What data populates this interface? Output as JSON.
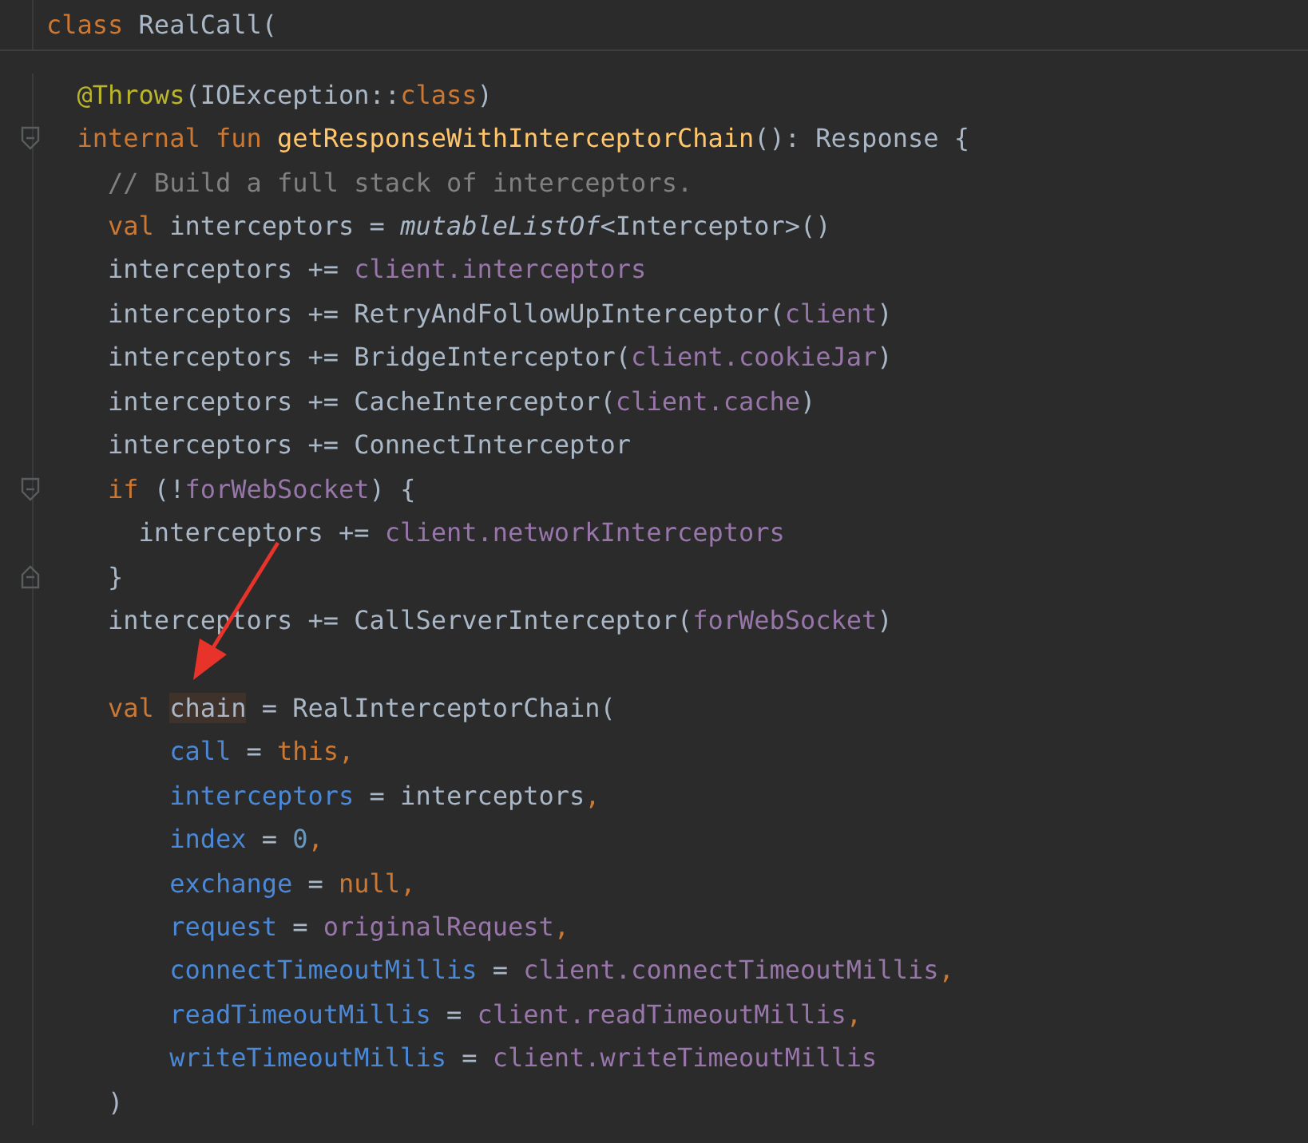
{
  "sticky_header": {
    "tokens": [
      {
        "text": "class ",
        "kind": "keyword"
      },
      {
        "text": "RealCall(",
        "kind": "plain"
      }
    ]
  },
  "lines": [
    {
      "kind": "code",
      "tokens": [
        {
          "text": "@Throws",
          "kind": "annotation"
        },
        {
          "text": "(IOException::",
          "kind": "plain"
        },
        {
          "text": "class",
          "kind": "keyword"
        },
        {
          "text": ")",
          "kind": "plain"
        }
      ]
    },
    {
      "kind": "fold-start",
      "tokens": [
        {
          "text": "internal fun ",
          "kind": "keyword"
        },
        {
          "text": "getResponseWithInterceptorChain",
          "kind": "function"
        },
        {
          "text": "(): Response {",
          "kind": "plain"
        }
      ],
      "children": [
        {
          "kind": "code",
          "tokens": [
            {
              "text": "// Build a full stack of interceptors.",
              "kind": "comment"
            }
          ]
        },
        {
          "kind": "code",
          "tokens": [
            {
              "text": "val ",
              "kind": "keyword"
            },
            {
              "text": "interceptors = ",
              "kind": "plain"
            },
            {
              "text": "mutableListOf",
              "kind": "call"
            },
            {
              "text": "<Interceptor>()",
              "kind": "plain"
            }
          ]
        },
        {
          "kind": "code",
          "tokens": [
            {
              "text": "interceptors += ",
              "kind": "plain"
            },
            {
              "text": "client.interceptors",
              "kind": "property"
            }
          ]
        },
        {
          "kind": "code",
          "tokens": [
            {
              "text": "interceptors += RetryAndFollowUpInterceptor(",
              "kind": "plain"
            },
            {
              "text": "client",
              "kind": "property"
            },
            {
              "text": ")",
              "kind": "plain"
            }
          ]
        },
        {
          "kind": "code",
          "tokens": [
            {
              "text": "interceptors += BridgeInterceptor(",
              "kind": "plain"
            },
            {
              "text": "client.cookieJar",
              "kind": "property"
            },
            {
              "text": ")",
              "kind": "plain"
            }
          ]
        },
        {
          "kind": "code",
          "tokens": [
            {
              "text": "interceptors += CacheInterceptor(",
              "kind": "plain"
            },
            {
              "text": "client.cache",
              "kind": "property"
            },
            {
              "text": ")",
              "kind": "plain"
            }
          ]
        },
        {
          "kind": "code",
          "tokens": [
            {
              "text": "interceptors += ConnectInterceptor",
              "kind": "plain"
            }
          ]
        },
        {
          "kind": "fold-start",
          "tokens": [
            {
              "text": "if",
              "kind": "keyword"
            },
            {
              "text": " (!",
              "kind": "plain"
            },
            {
              "text": "forWebSocket",
              "kind": "property"
            },
            {
              "text": ") {",
              "kind": "plain"
            }
          ],
          "children": [
            {
              "kind": "code",
              "tokens": [
                {
                  "text": "interceptors += ",
                  "kind": "plain"
                },
                {
                  "text": "client.networkInterceptors",
                  "kind": "property"
                }
              ]
            }
          ]
        },
        {
          "kind": "fold-end",
          "tokens": [
            {
              "text": "}",
              "kind": "plain"
            }
          ]
        },
        {
          "kind": "code",
          "tokens": [
            {
              "text": "interceptors += CallServerInterceptor(",
              "kind": "plain"
            },
            {
              "text": "forWebSocket",
              "kind": "property"
            },
            {
              "text": ")",
              "kind": "plain"
            }
          ]
        },
        {
          "kind": "blank"
        },
        {
          "kind": "call-open",
          "tokens": [
            {
              "text": "val ",
              "kind": "keyword"
            },
            {
              "text": "chain",
              "kind": "highlighted"
            },
            {
              "text": " = RealInterceptorChain(",
              "kind": "plain"
            }
          ],
          "children": [
            {
              "kind": "code",
              "tokens": [
                {
                  "text": "call",
                  "kind": "param"
                },
                {
                  "text": " = ",
                  "kind": "plain"
                },
                {
                  "text": "this",
                  "kind": "keyword"
                },
                {
                  "text": ",",
                  "kind": "keyword"
                }
              ]
            },
            {
              "kind": "code",
              "tokens": [
                {
                  "text": "interceptors",
                  "kind": "param"
                },
                {
                  "text": " = interceptors",
                  "kind": "plain"
                },
                {
                  "text": ",",
                  "kind": "keyword"
                }
              ]
            },
            {
              "kind": "code",
              "tokens": [
                {
                  "text": "index",
                  "kind": "param"
                },
                {
                  "text": " = ",
                  "kind": "plain"
                },
                {
                  "text": "0",
                  "kind": "number"
                },
                {
                  "text": ",",
                  "kind": "keyword"
                }
              ]
            },
            {
              "kind": "code",
              "tokens": [
                {
                  "text": "exchange",
                  "kind": "param"
                },
                {
                  "text": " = ",
                  "kind": "plain"
                },
                {
                  "text": "null",
                  "kind": "keyword"
                },
                {
                  "text": ",",
                  "kind": "keyword"
                }
              ]
            },
            {
              "kind": "code",
              "tokens": [
                {
                  "text": "request",
                  "kind": "param"
                },
                {
                  "text": " = ",
                  "kind": "plain"
                },
                {
                  "text": "originalRequest",
                  "kind": "property"
                },
                {
                  "text": ",",
                  "kind": "keyword"
                }
              ]
            },
            {
              "kind": "code",
              "tokens": [
                {
                  "text": "connectTimeoutMillis",
                  "kind": "param"
                },
                {
                  "text": " = ",
                  "kind": "plain"
                },
                {
                  "text": "client.connectTimeoutMillis",
                  "kind": "property"
                },
                {
                  "text": ",",
                  "kind": "keyword"
                }
              ]
            },
            {
              "kind": "code",
              "tokens": [
                {
                  "text": "readTimeoutMillis",
                  "kind": "param"
                },
                {
                  "text": " = ",
                  "kind": "plain"
                },
                {
                  "text": "client.readTimeoutMillis",
                  "kind": "property"
                },
                {
                  "text": ",",
                  "kind": "keyword"
                }
              ]
            },
            {
              "kind": "code",
              "tokens": [
                {
                  "text": "writeTimeoutMillis",
                  "kind": "param"
                },
                {
                  "text": " = ",
                  "kind": "plain"
                },
                {
                  "text": "client.writeTimeoutMillis",
                  "kind": "property"
                }
              ]
            }
          ]
        },
        {
          "kind": "code",
          "tokens": [
            {
              "text": ")",
              "kind": "plain"
            }
          ]
        }
      ]
    }
  ]
}
